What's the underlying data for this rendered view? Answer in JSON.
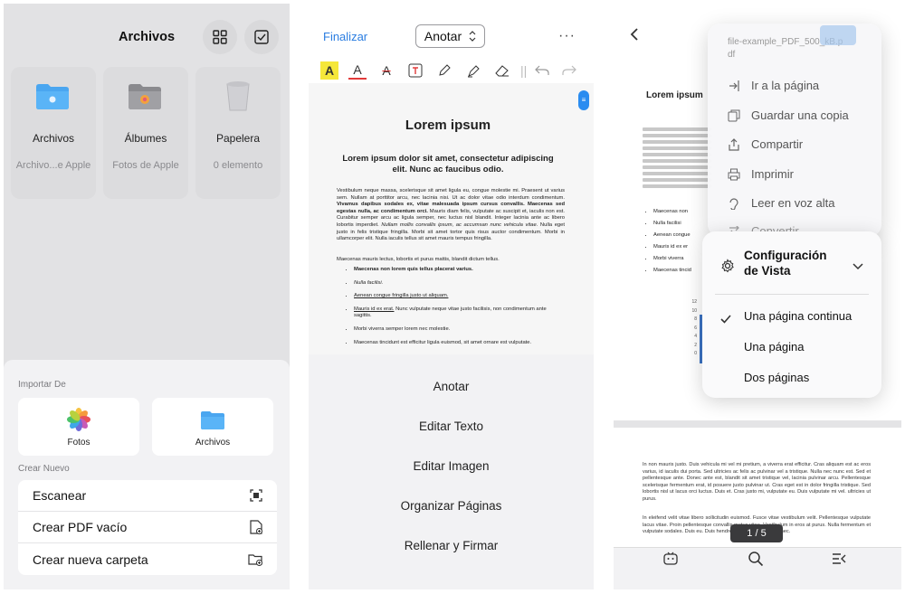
{
  "files": {
    "title": "Archivos",
    "cards": [
      {
        "name": "Archivos",
        "sub": "Archivo...e Apple"
      },
      {
        "name": "Álbumes",
        "sub": "Fotos de Apple"
      },
      {
        "name": "Papelera",
        "sub": "0 elemento"
      }
    ],
    "import_header": "Importar De",
    "import_tiles": [
      "Fotos",
      "Archivos"
    ],
    "create_header": "Crear Nuevo",
    "create_rows": [
      "Escanear",
      "Crear PDF vacío",
      "Crear nueva carpeta"
    ]
  },
  "editor": {
    "done": "Finalizar",
    "mode": "Anotar",
    "doc_title": "Lorem ipsum",
    "doc_subtitle": "Lorem ipsum dolor sit amet, consectetur adipiscing elit. Nunc ac faucibus odio.",
    "para1_start": "Vestibulum neque massa, scelerisque sit amet ligula eu, congue molestie mi. Praesent ut varius sem. Nullam at porttitor arcu, nec lacinia nisi. Ut ac dolor vitae odio interdum condimentum. ",
    "para1_bold": "Vivamus dapibus sodales ex, vitae malesuada ipsum cursus convallis. Maecenas sed egestas nulla, ac condimentum orci.",
    "para1_mid": " Mauris diam felis, vulputate ac suscipit et, iaculis non est. Curabitur semper arcu ac ligula semper, nec luctus nisl blandit. Integer lacinia ante ac libero lobortis imperdiet. ",
    "para1_italic": "Nullam mollis convallis ipsum, ac accumsan nunc vehicula vitae.",
    "para1_end": " Nulla eget justo in felis tristique fringilla. Morbi sit amet tortor quis risus auctor condimentum. Morbi in ullamcorper elit. Nulla iaculis tellus sit amet mauris tempus fringilla.",
    "para2": "Maecenas mauris lectus, lobortis et purus mattis, blandit dictum tellus.",
    "bullets": [
      "Maecenas non lorem quis tellus placerat varius.",
      "Nulla facilisi.",
      "Aenean congue fringilla justo ut aliquam.",
      "Mauris id ex erat.",
      " Nunc vulputate neque vitae justo facilisis, non condimentum ante sagittis.",
      "Morbi viverra semper lorem nec molestie.",
      "Maecenas tincidunt est efficitur ligula euismod, sit amet ornare est vulputate."
    ],
    "menu": [
      "Anotar",
      "Editar Texto",
      "Editar Imagen",
      "Organizar Páginas",
      "Rellenar y Firmar"
    ]
  },
  "viewer": {
    "filename": "file-example_PDF_500_kB.pdf",
    "menu": [
      "Ir a la página",
      "Guardar una copia",
      "Compartir",
      "Imprimir",
      "Leer en voz alta",
      "Convertir"
    ],
    "view_settings": "Configuración de Vista",
    "view_options": [
      "Una página continua",
      "Una página",
      "Dos páginas"
    ],
    "selected_option": 0,
    "page_indicator": "1 / 5",
    "behind_title": "Lorem ipsum",
    "behind_bullets": [
      "Maecenas non",
      "Nulla facilisi",
      "Aenean congue",
      "Mauris id ex er",
      "Morbi viverra",
      "Maecenas tincid"
    ],
    "chart_ticks": [
      "12",
      "10",
      "8",
      "6",
      "4",
      "2",
      "0"
    ],
    "page2_p1": "In non mauris justo. Duis vehicula mi vel mi pretium, a viverra erat efficitur. Cras aliquam est ac eros varius, id iaculis dui porta. Sed ultricies ac felis ac pulvinar vel a tristique. Nulla nec nunc est. Sed et pellentesque ante. Donec ante est, blandit sit amet tristique vel, lacinia pulvinar arcu. Pellentesque scelerisque fermentum erat, id posuere justo pulvinar ut. Cras eget est in dolor fringilla tristique. Sed lobortis nisl ut lacus orci luctus. Duis et. Cras justo mi, vulputate eu. Duis vulputate mi vel. ultricies ut purus.",
    "page2_p2": "In eleifend velit vitae libero sollicitudin euismod. Fusce vitae vestibulum velit. Pellentesque vulputate lacus vitae. Proin pellentesque convallis metus vitae. Vestibulum in eros at purus. Nulla fermentum et vulputate sodales. Duis eu. Duis hendrerit tortor. Cras id eros nec."
  }
}
